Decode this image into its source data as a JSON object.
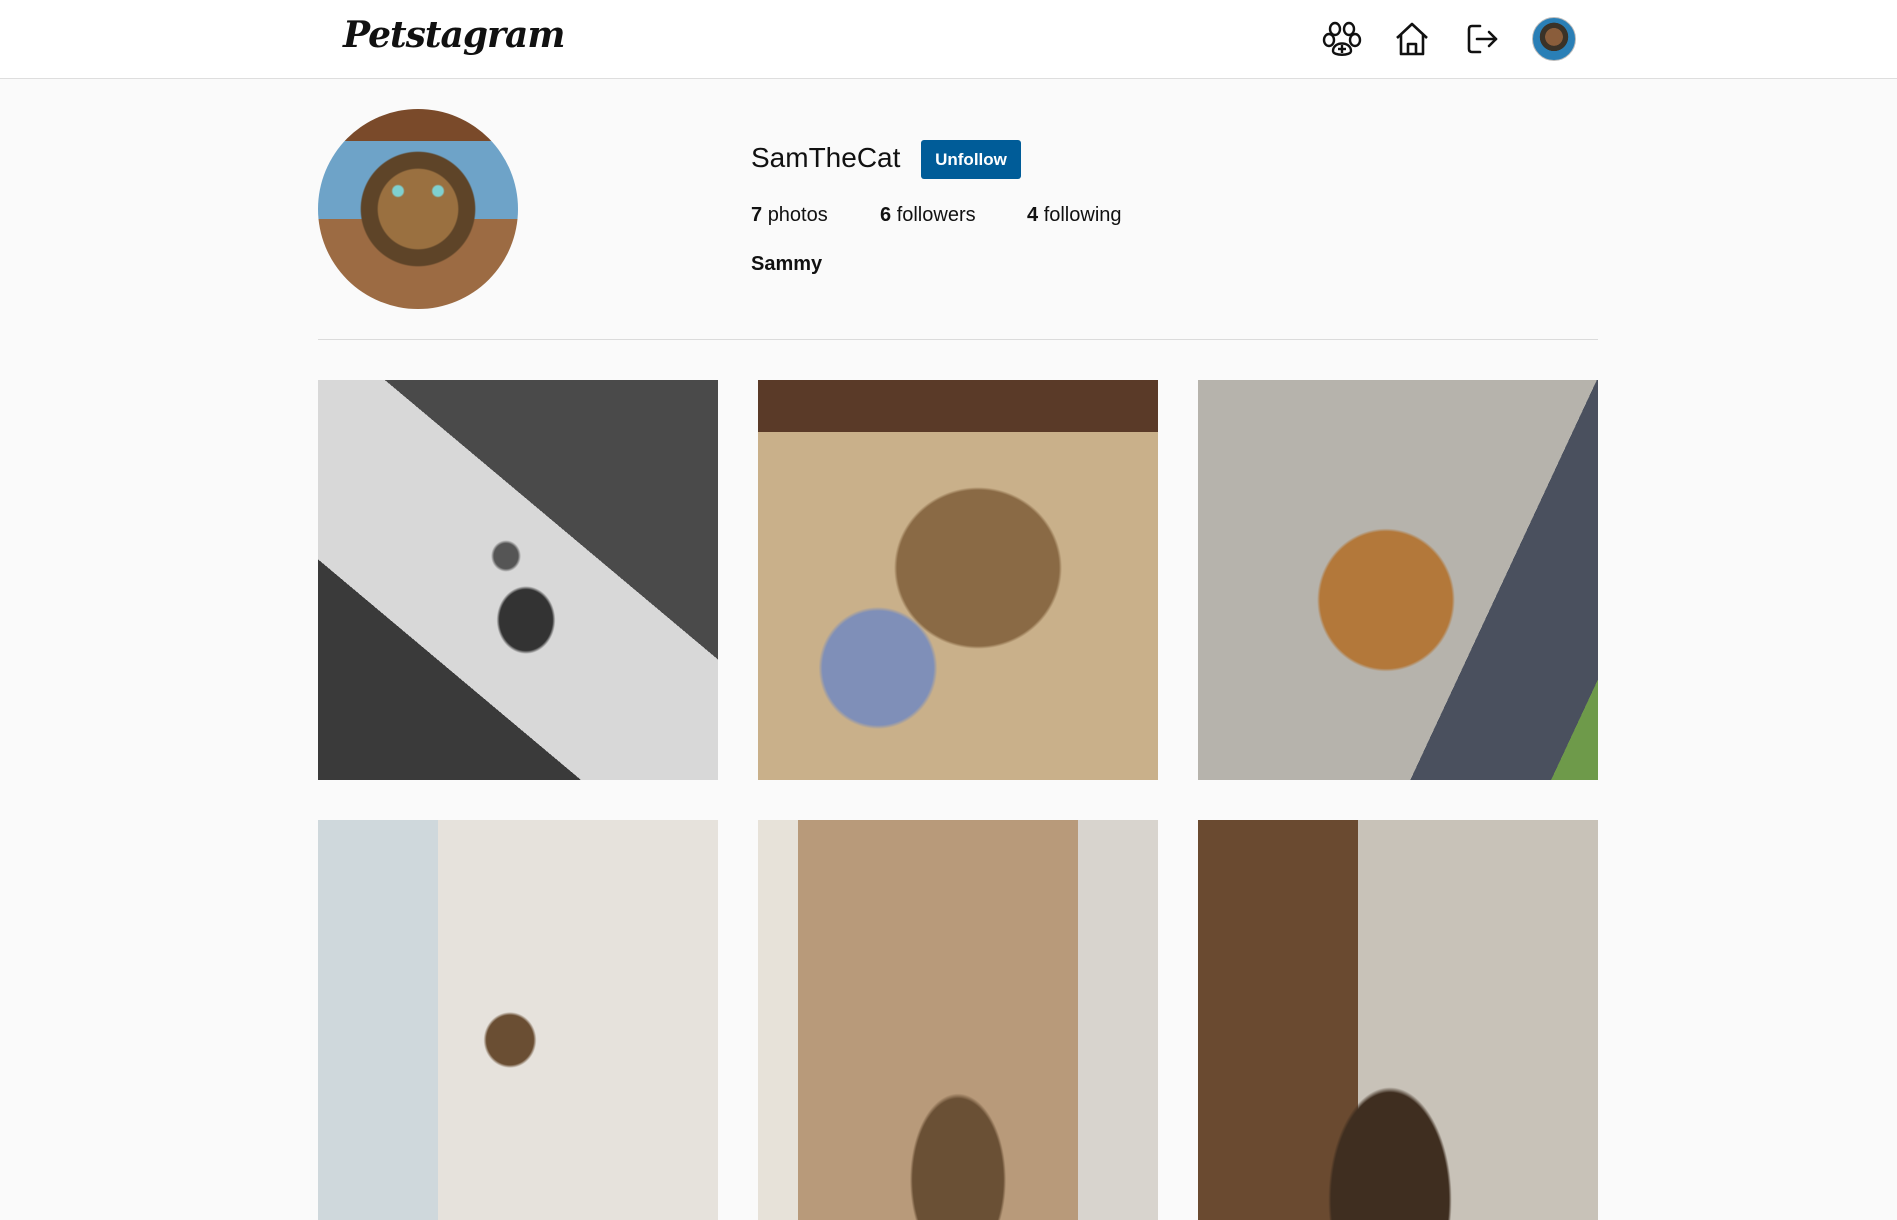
{
  "header": {
    "logo_text": "Petstagram",
    "icons": [
      "paw-plus-icon",
      "home-icon",
      "logout-icon",
      "avatar"
    ]
  },
  "profile": {
    "username": "SamTheCat",
    "follow_button_label": "Unfollow",
    "stats": [
      {
        "count": "7",
        "label": "photos"
      },
      {
        "count": "6",
        "label": "followers"
      },
      {
        "count": "4",
        "label": "following"
      }
    ],
    "full_name": "Sammy"
  },
  "colors": {
    "accent": "#005c98",
    "background": "#fafafa",
    "header_background": "#ffffff"
  }
}
